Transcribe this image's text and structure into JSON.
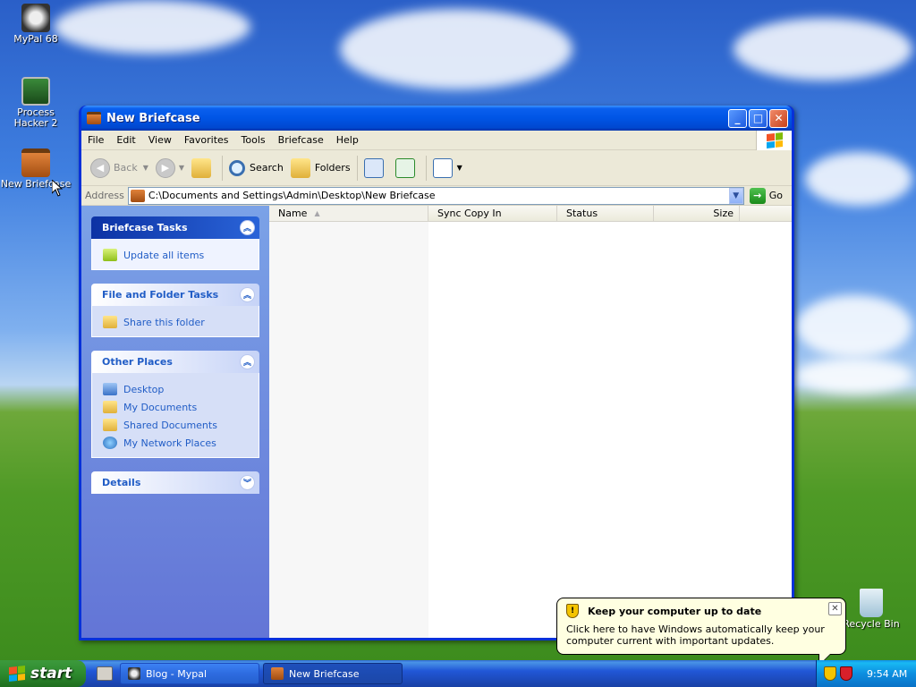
{
  "desktop": {
    "icons": [
      {
        "label": "MyPal 68"
      },
      {
        "label": "Process Hacker 2"
      },
      {
        "label": "New Briefcase"
      },
      {
        "label": "Recycle Bin"
      }
    ]
  },
  "window": {
    "title": "New Briefcase",
    "menu": [
      "File",
      "Edit",
      "View",
      "Favorites",
      "Tools",
      "Briefcase",
      "Help"
    ],
    "toolbar": {
      "back": "Back",
      "search": "Search",
      "folders": "Folders"
    },
    "address": {
      "label": "Address",
      "value": "C:\\Documents and Settings\\Admin\\Desktop\\New Briefcase",
      "go": "Go"
    },
    "taskpane": {
      "briefcase_tasks": {
        "title": "Briefcase Tasks",
        "items": [
          "Update all items"
        ]
      },
      "file_folder_tasks": {
        "title": "File and Folder Tasks",
        "items": [
          "Share this folder"
        ]
      },
      "other_places": {
        "title": "Other Places",
        "items": [
          "Desktop",
          "My Documents",
          "Shared Documents",
          "My Network Places"
        ]
      },
      "details": {
        "title": "Details"
      }
    },
    "columns": [
      "Name",
      "Sync Copy In",
      "Status",
      "Size"
    ]
  },
  "balloon": {
    "title": "Keep your computer up to date",
    "body": "Click here to have Windows automatically keep your computer current with important updates."
  },
  "taskbar": {
    "start": "start",
    "items": [
      "Blog - Mypal",
      "New Briefcase"
    ],
    "clock": "9:54 AM"
  },
  "colors": {
    "title_blue": "#0055e5",
    "taskpane_link": "#215dc6",
    "start_green": "#2e8a2e",
    "balloon_bg": "#ffffe1"
  }
}
